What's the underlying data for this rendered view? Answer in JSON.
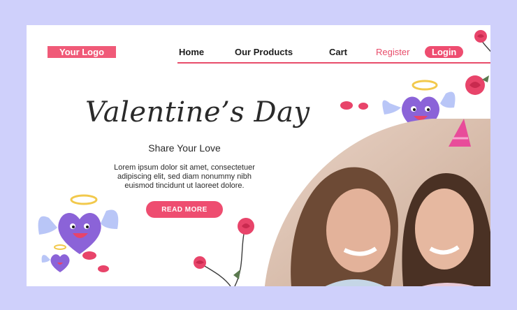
{
  "brand": {
    "logo_text": "Your Logo"
  },
  "nav": {
    "items": [
      {
        "label": "Home"
      },
      {
        "label": "Our Products"
      },
      {
        "label": "Cart"
      },
      {
        "label": "Register"
      },
      {
        "label": "Login"
      }
    ]
  },
  "hero": {
    "title": "Valentine’s Day",
    "subtitle": "Share Your Love",
    "body": "Lorem ipsum dolor sit amet, consectetuer adipiscing elit, sed diam nonummy nibh euismod tincidunt ut laoreet dolore.",
    "cta_label": "READ MORE"
  },
  "colors": {
    "accent": "#ee4d70",
    "background": "#cfd0fb",
    "heart": "#8b63d8"
  },
  "icons": [
    "heart-angel-icon",
    "rose-icon",
    "lips-icon",
    "party-hat-icon"
  ]
}
